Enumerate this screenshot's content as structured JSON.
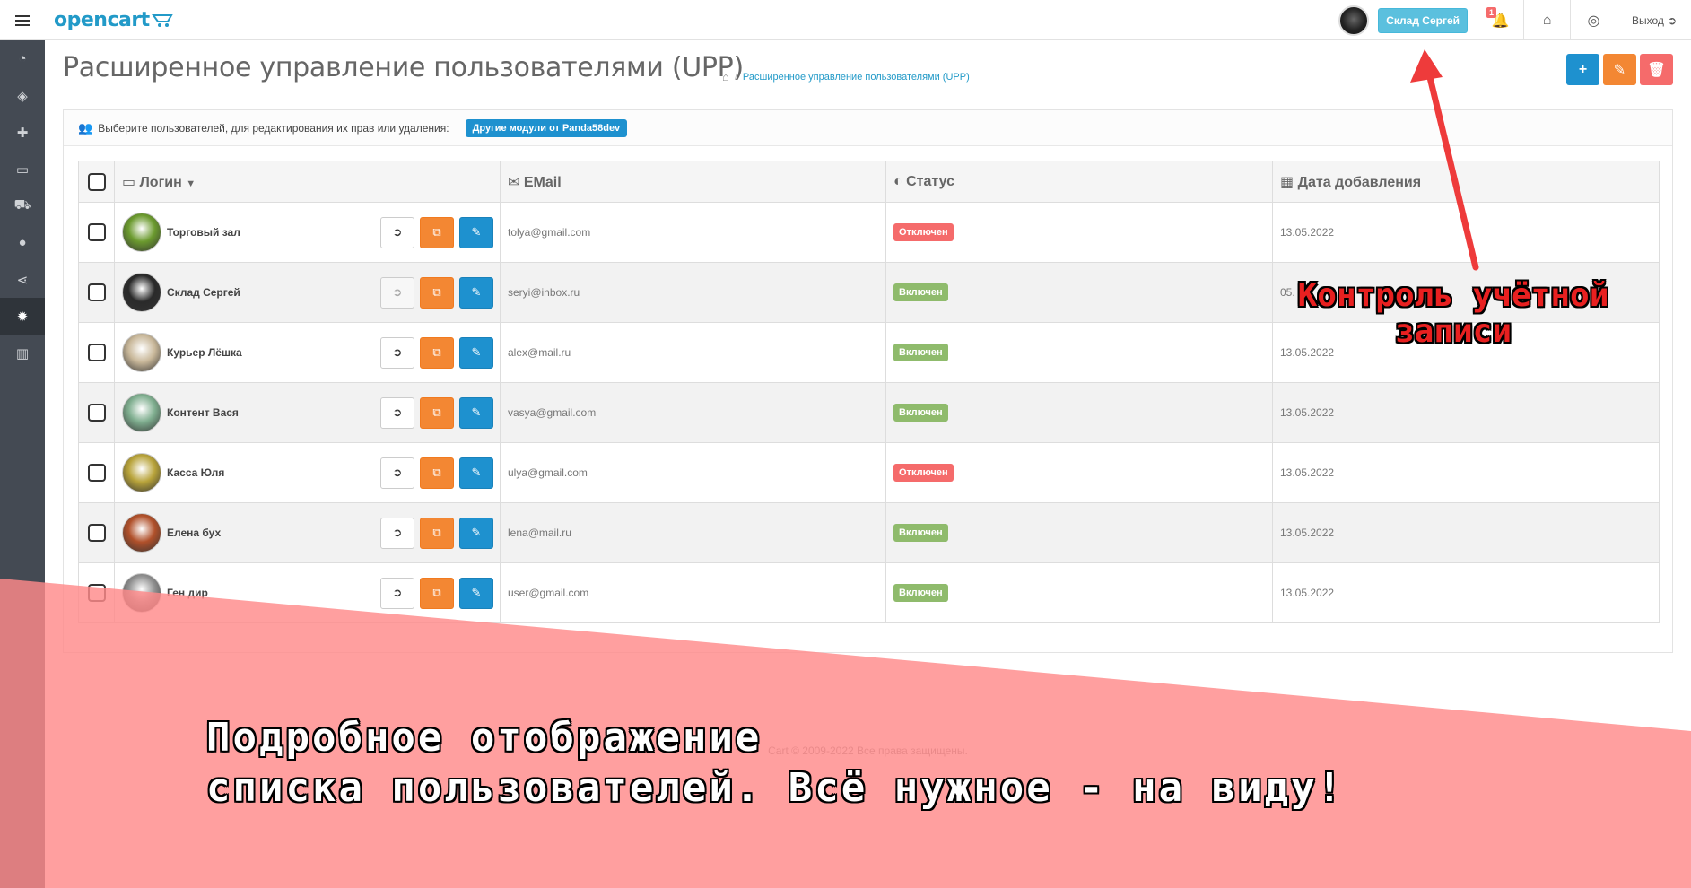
{
  "header": {
    "logo_text": "opencart",
    "current_user_label": "Склад Сергей",
    "notification_count": "1",
    "logout_label": "Выход"
  },
  "sidebar": {
    "items": [
      {
        "name": "dashboard-icon",
        "glyph": "◔"
      },
      {
        "name": "tags-icon",
        "glyph": "◈"
      },
      {
        "name": "puzzle-icon",
        "glyph": "✚"
      },
      {
        "name": "desktop-icon",
        "glyph": "▭"
      },
      {
        "name": "cart-icon",
        "glyph": "⛟"
      },
      {
        "name": "user-icon",
        "glyph": "●"
      },
      {
        "name": "share-icon",
        "glyph": "⋖"
      },
      {
        "name": "cog-icon",
        "glyph": "✹",
        "active": true
      },
      {
        "name": "bar-chart-icon",
        "glyph": "▥"
      }
    ]
  },
  "page": {
    "title": "Расширенное управление пользователями (UPP)",
    "breadcrumb": "Расширенное управление пользователями (UPP)"
  },
  "panel": {
    "heading_text": "Выберите пользователей, для редактирования их прав или удаления:",
    "other_modules_label": "Другие модули от Panda58dev"
  },
  "table": {
    "headers": {
      "login": "Логин",
      "email": "EMail",
      "status": "Статус",
      "date": "Дата добавления"
    },
    "rows": [
      {
        "name": "Торговый зал",
        "email": "tolya@gmail.com",
        "status": "Отключен",
        "enabled": false,
        "date": "13.05.2022",
        "avatar": "#6b9a2e",
        "login_dim": false
      },
      {
        "name": "Склад Сергей",
        "email": "seryi@inbox.ru",
        "status": "Включен",
        "enabled": true,
        "date": "05.",
        "avatar": "#2a2a2a",
        "login_dim": true
      },
      {
        "name": "Курьер Лёшка",
        "email": "alex@mail.ru",
        "status": "Включен",
        "enabled": true,
        "date": "13.05.2022",
        "avatar": "#c9b89a",
        "login_dim": false
      },
      {
        "name": "Контент Вася",
        "email": "vasya@gmail.com",
        "status": "Включен",
        "enabled": true,
        "date": "13.05.2022",
        "avatar": "#7fae8f",
        "login_dim": false
      },
      {
        "name": "Касса Юля",
        "email": "ulya@gmail.com",
        "status": "Отключен",
        "enabled": false,
        "date": "13.05.2022",
        "avatar": "#b8a33a",
        "login_dim": false
      },
      {
        "name": "Елена бух",
        "email": "lena@mail.ru",
        "status": "Включен",
        "enabled": true,
        "date": "13.05.2022",
        "avatar": "#b0502a",
        "login_dim": false
      },
      {
        "name": "Ген дир",
        "email": "user@gmail.com",
        "status": "Включен",
        "enabled": true,
        "date": "13.05.2022",
        "avatar": "#8f8f8f",
        "login_dim": false
      }
    ]
  },
  "footer": {
    "line1": "Cart © 2009-2022 Все права защищены."
  },
  "promo": {
    "line1": "Подробное отображение",
    "line2": "списка пользователей. Всё нужное - на виду!",
    "callout_line1": "Контроль учётной",
    "callout_line2": "записи",
    "overlay_color": "#ff8a8a",
    "arrow_color": "#ee3b3b"
  }
}
